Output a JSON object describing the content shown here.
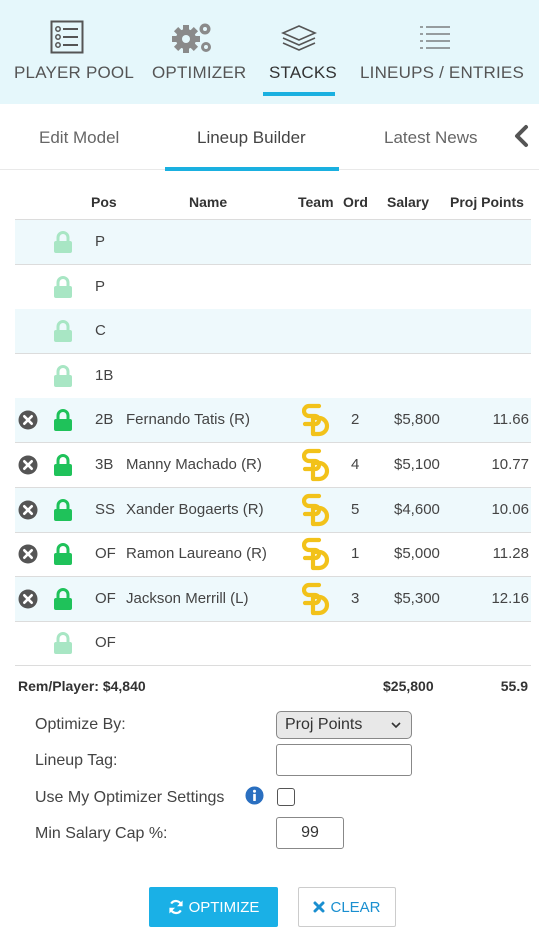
{
  "nav": {
    "items": [
      {
        "label": "PLAYER POOL",
        "icon": "player-pool-icon"
      },
      {
        "label": "OPTIMIZER",
        "icon": "gears-icon"
      },
      {
        "label": "STACKS",
        "icon": "stacks-icon",
        "active": true
      },
      {
        "label": "LINEUPS / ENTRIES",
        "icon": "lineups-list-icon"
      }
    ]
  },
  "subtabs": {
    "items": [
      {
        "label": "Edit Model"
      },
      {
        "label": "Lineup Builder",
        "active": true
      },
      {
        "label": "Latest News"
      }
    ],
    "overflow_icon": "chevron-left-icon"
  },
  "table": {
    "headers": {
      "pos": "Pos",
      "name": "Name",
      "team": "Team",
      "ord": "Ord",
      "salary": "Salary",
      "proj": "Proj Points"
    },
    "rows": [
      {
        "pos": "P",
        "name": "",
        "ord": "",
        "salary": "",
        "proj": "",
        "filled": false
      },
      {
        "pos": "P",
        "name": "",
        "ord": "",
        "salary": "",
        "proj": "",
        "filled": false
      },
      {
        "pos": "C",
        "name": "",
        "ord": "",
        "salary": "",
        "proj": "",
        "filled": false
      },
      {
        "pos": "1B",
        "name": "",
        "ord": "",
        "salary": "",
        "proj": "",
        "filled": false
      },
      {
        "pos": "2B",
        "name": "Fernando Tatis (R)",
        "ord": "2",
        "salary": "$5,800",
        "proj": "11.66",
        "filled": true,
        "team_logo": "padres-logo-icon"
      },
      {
        "pos": "3B",
        "name": "Manny Machado (R)",
        "ord": "4",
        "salary": "$5,100",
        "proj": "10.77",
        "filled": true,
        "team_logo": "padres-logo-icon"
      },
      {
        "pos": "SS",
        "name": "Xander Bogaerts (R)",
        "ord": "5",
        "salary": "$4,600",
        "proj": "10.06",
        "filled": true,
        "team_logo": "padres-logo-icon"
      },
      {
        "pos": "OF",
        "name": "Ramon Laureano (R)",
        "ord": "1",
        "salary": "$5,000",
        "proj": "11.28",
        "filled": true,
        "team_logo": "padres-logo-icon"
      },
      {
        "pos": "OF",
        "name": "Jackson Merrill (L)",
        "ord": "3",
        "salary": "$5,300",
        "proj": "12.16",
        "filled": true,
        "team_logo": "padres-logo-icon"
      },
      {
        "pos": "OF",
        "name": "",
        "ord": "",
        "salary": "",
        "proj": "",
        "filled": false
      }
    ],
    "totals": {
      "rem_player": "Rem/Player: $4,840",
      "salary": "$25,800",
      "proj": "55.9"
    }
  },
  "form": {
    "optimize_by_label": "Optimize By:",
    "optimize_by_value": "Proj Points",
    "lineup_tag_label": "Lineup Tag:",
    "lineup_tag_value": "",
    "use_settings_label": "Use My Optimizer Settings",
    "use_settings_checked": false,
    "min_salary_label": "Min Salary Cap %:",
    "min_salary_value": "99"
  },
  "buttons": {
    "optimize": "OPTIMIZE",
    "clear": "CLEAR"
  },
  "colors": {
    "accent": "#1ab0e0",
    "nav_bg": "#e5f7fb",
    "row_alt": "#eef9fc",
    "lock_locked": "#1fc25a",
    "lock_unlocked": "#a8e6c4",
    "padres_gold": "#f2c21a",
    "remove": "#555555"
  }
}
